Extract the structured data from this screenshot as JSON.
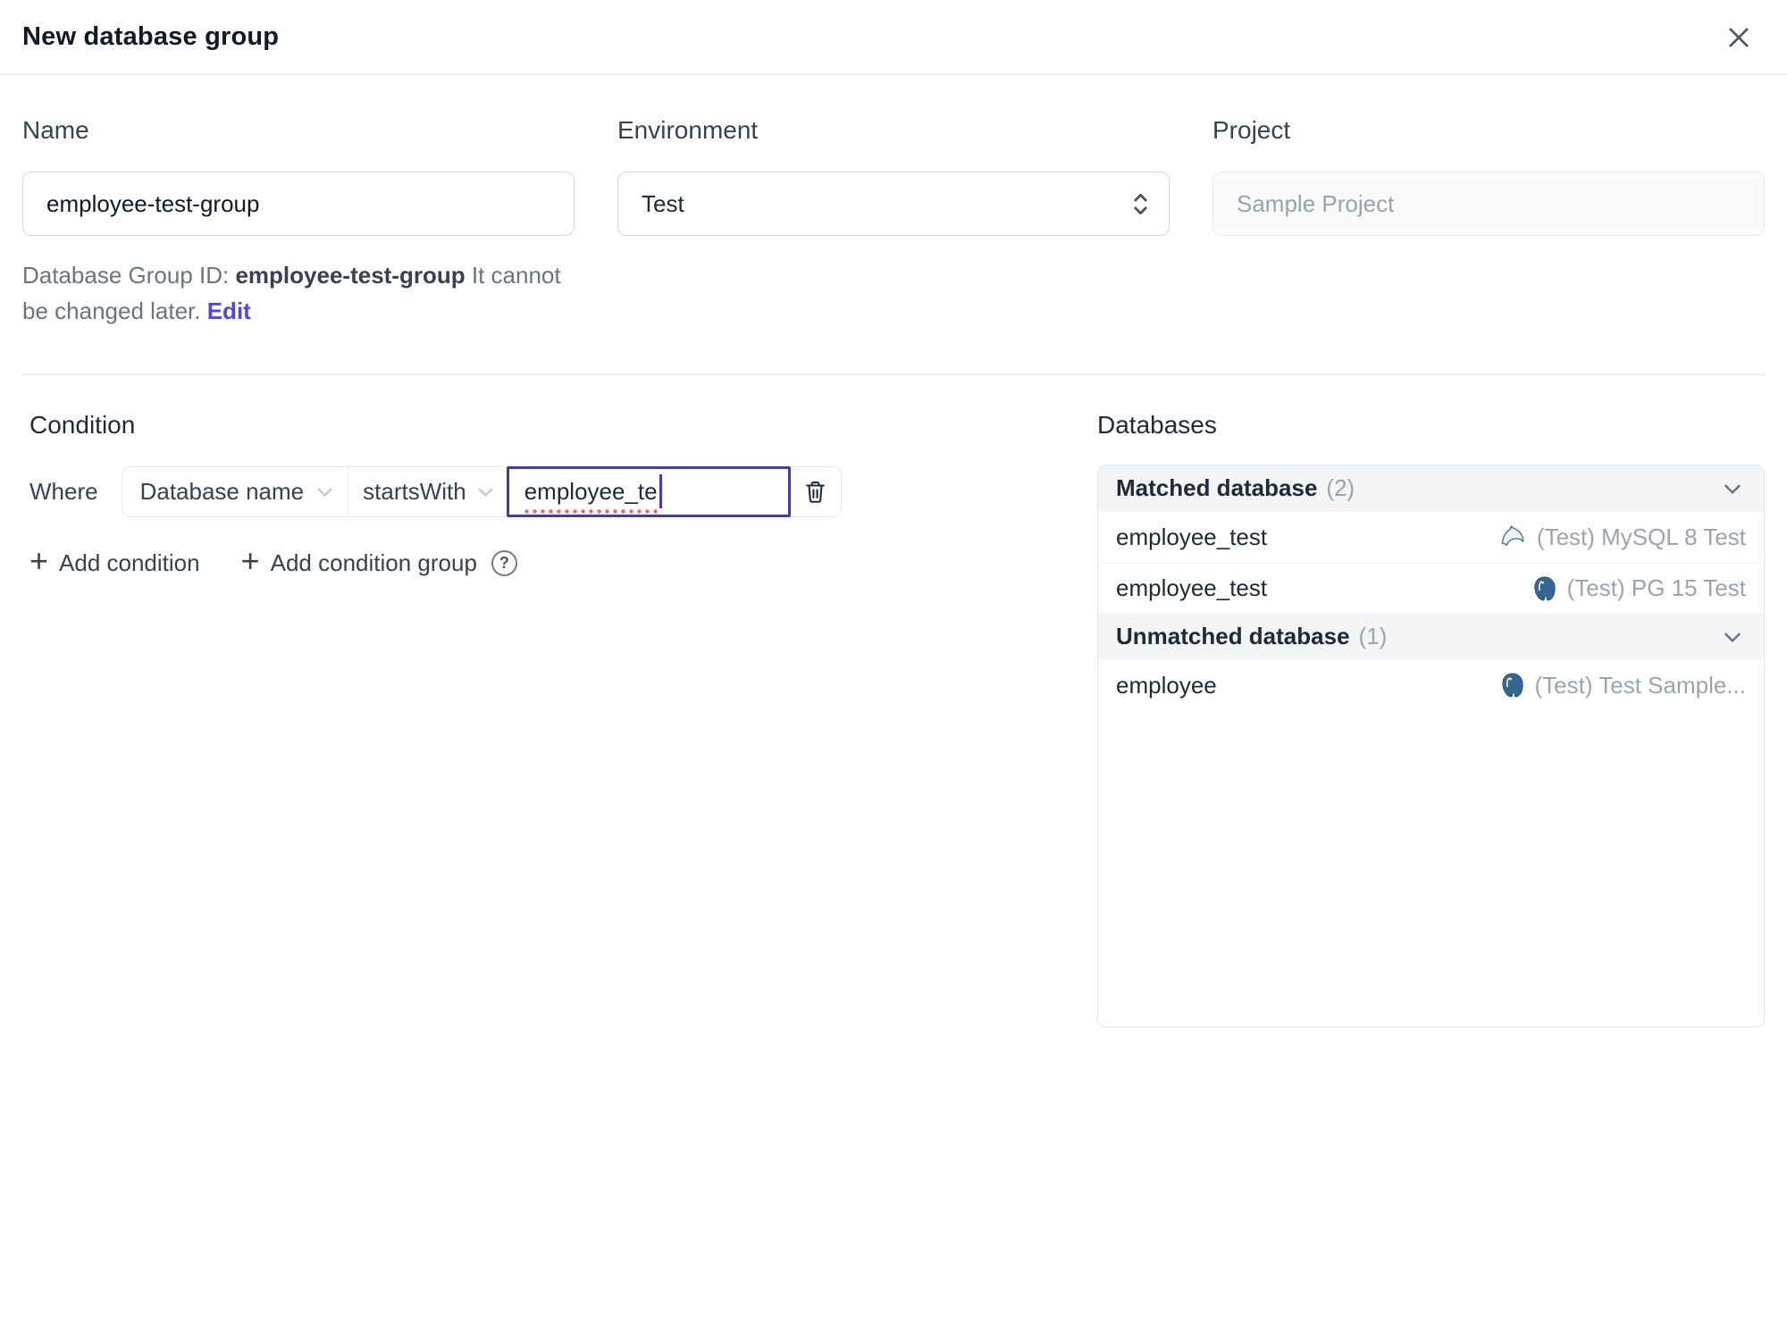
{
  "header": {
    "title": "New database group"
  },
  "icons": {
    "plus": "+",
    "help": "?"
  },
  "form": {
    "name": {
      "label": "Name",
      "value": "employee-test-group"
    },
    "environment": {
      "label": "Environment",
      "value": "Test"
    },
    "project": {
      "label": "Project",
      "value": "Sample Project"
    },
    "id_note": {
      "prefix": "Database Group ID: ",
      "id": "employee-test-group",
      "suffix": " It cannot be changed later. ",
      "edit_label": "Edit"
    }
  },
  "condition": {
    "heading": "Condition",
    "where_label": "Where",
    "field_selector": "Database name",
    "operator_selector": "startsWith",
    "value": "employee_te",
    "add_condition": "Add condition",
    "add_condition_group": "Add condition group"
  },
  "databases": {
    "heading": "Databases",
    "matched": {
      "title": "Matched database",
      "count": "(2)",
      "rows": [
        {
          "name": "employee_test",
          "engine": "mysql-icon",
          "instance": "(Test) MySQL 8 Test"
        },
        {
          "name": "employee_test",
          "engine": "postgres-icon",
          "instance": "(Test) PG 15 Test"
        }
      ]
    },
    "unmatched": {
      "title": "Unmatched database",
      "count": "(1)",
      "rows": [
        {
          "name": "employee",
          "engine": "postgres-icon",
          "instance": "(Test) Test Sample..."
        }
      ]
    }
  },
  "colors": {
    "accent": "#4f46e5",
    "focus_border": "#3f3daa",
    "spellcheck_dots": "#f26a63",
    "section_header_bg": "#f3f4f6",
    "mysql": "#4f7d9d",
    "postgres": "#336791"
  }
}
